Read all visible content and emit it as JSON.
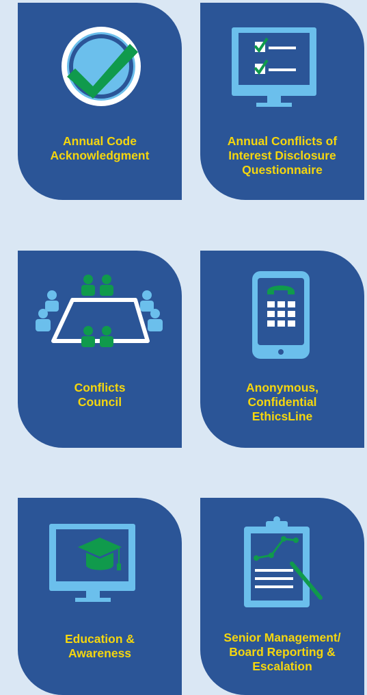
{
  "colors": {
    "background": "#dae7f4",
    "tile": "#2b5597",
    "label": "#f5d60e",
    "icon_light": "#6bbfec",
    "icon_green": "#109a4c",
    "icon_white": "#ffffff"
  },
  "tiles": [
    {
      "icon": "checkmark-badge-icon",
      "lines": [
        "Annual Code",
        "Acknowledgment"
      ]
    },
    {
      "icon": "monitor-checklist-icon",
      "lines": [
        "Annual Conflicts of",
        "Interest Disclosure",
        "Questionnaire"
      ]
    },
    {
      "icon": "meeting-table-icon",
      "lines": [
        "Conflicts",
        "Council"
      ]
    },
    {
      "icon": "mobile-phone-icon",
      "lines": [
        "Anonymous,",
        "Confidential",
        "EthicsLine"
      ]
    },
    {
      "icon": "monitor-graduation-cap-icon",
      "lines": [
        "Education &",
        "Awareness"
      ]
    },
    {
      "icon": "clipboard-chart-icon",
      "lines": [
        "Senior Management/",
        "Board Reporting &",
        "Escalation"
      ]
    }
  ]
}
